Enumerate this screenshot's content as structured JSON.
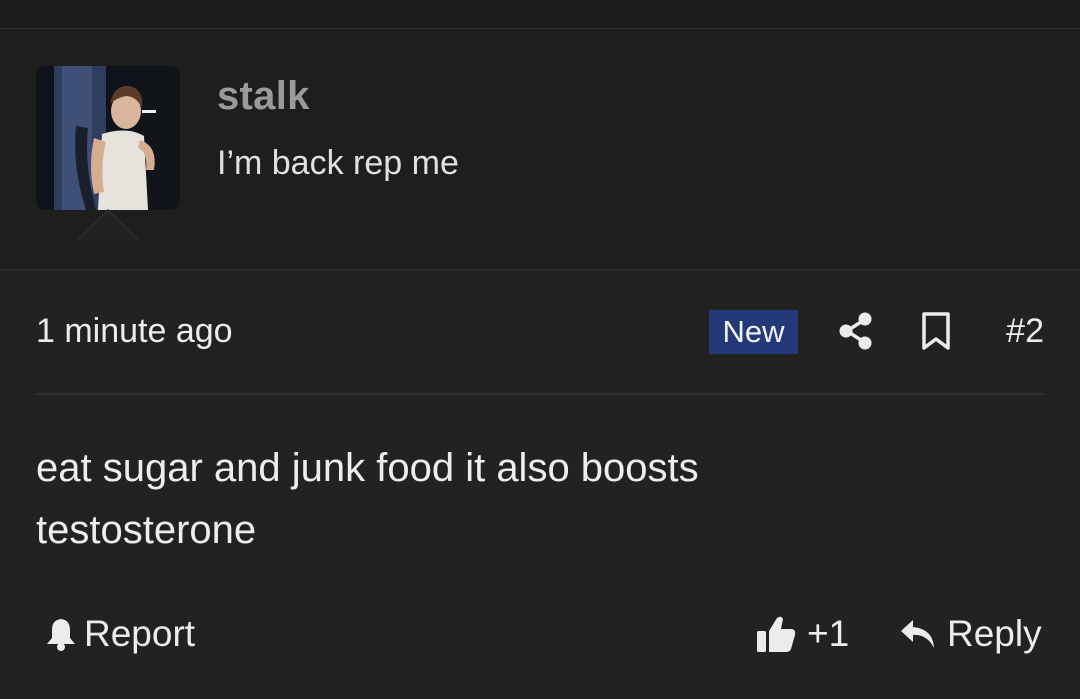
{
  "post": {
    "username": "stalk",
    "user_title": "I’m back rep me",
    "timestamp": "1 minute ago",
    "new_badge": "New",
    "post_number": "#2",
    "body_line1": "eat sugar and junk food it also boosts",
    "body_line2": "testosterone"
  },
  "actions": {
    "report_label": "Report",
    "like_count": "+1",
    "reply_label": "Reply"
  },
  "icons": {
    "share": "share-icon",
    "bookmark": "bookmark-icon",
    "report": "bell-icon",
    "like": "thumbs-up-icon",
    "reply": "reply-arrow-icon"
  },
  "colors": {
    "background": "#222222",
    "header_background": "#1e1e1e",
    "new_badge": "#24397a",
    "username": "#9a9a9a",
    "text": "#ececec"
  }
}
